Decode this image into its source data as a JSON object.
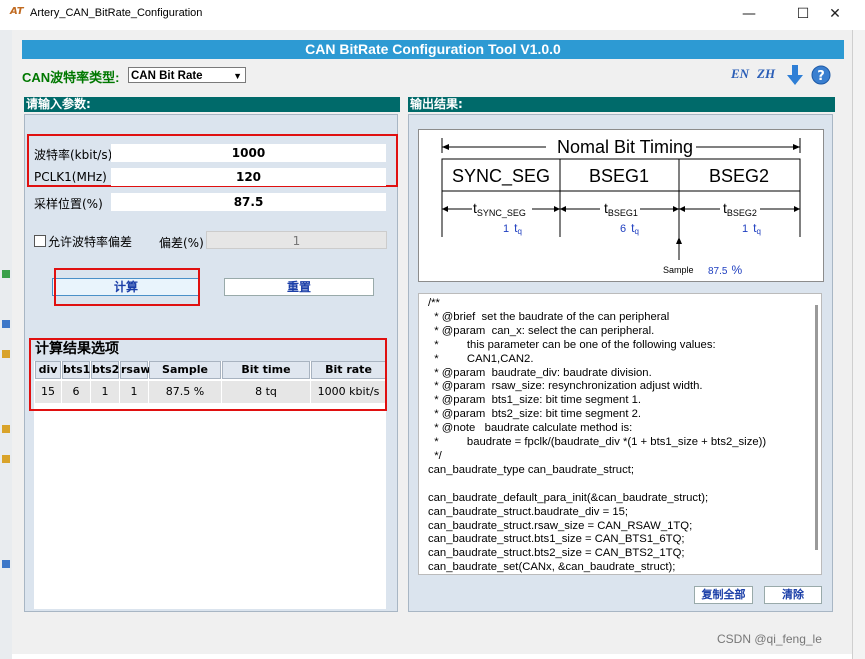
{
  "window": {
    "title": "Artery_CAN_BitRate_Configuration",
    "minimize": "—",
    "maximize": "☐",
    "close": "✕"
  },
  "header": {
    "title": "CAN BitRate Configuration Tool V1.0.0"
  },
  "type_selector": {
    "label": "CAN波特率类型:",
    "value": "CAN Bit Rate"
  },
  "lang": {
    "en": "EN",
    "zh": "ZH"
  },
  "input": {
    "section_title": "请输入参数:",
    "baud_label": "波特率(kbit/s)",
    "baud_value": "1000",
    "pclk_label": "PCLK1(MHz)",
    "pclk_value": "120",
    "sample_label": "采样位置(%)",
    "sample_value": "87.5",
    "allow_dev_label": "允许波特率偏差",
    "dev_label": "偏差(%)",
    "dev_value": "1",
    "calc_button": "计算",
    "reset_button": "重置"
  },
  "results": {
    "title": "计算结果选项",
    "columns": [
      "div",
      "bts1",
      "bts2",
      "rsaw",
      "Sample point",
      "Bit time length",
      "Bit rate"
    ],
    "rows": [
      [
        "15",
        "6",
        "1",
        "1",
        "87.5 %",
        "8 tq",
        "1000 kbit/s"
      ]
    ]
  },
  "output": {
    "section_title": "输出结果:",
    "diagram": {
      "title": "Nomal Bit Timing",
      "seg1": "SYNC_SEG",
      "seg2": "BSEG1",
      "seg3": "BSEG2",
      "t1_main": "t",
      "t1_sub": "SYNC_SEG",
      "t2_main": "t",
      "t2_sub": "BSEG1",
      "t3_main": "t",
      "t3_sub": "BSEG2",
      "v1": "1",
      "v2": "6",
      "v3": "1",
      "tq_main": "t",
      "tq_sub": "q",
      "sample_label": "Sample",
      "sample_value": "87.5",
      "sample_unit": "%"
    },
    "code": "/**\n  * @brief  set the baudrate of the can peripheral\n  * @param  can_x: select the can peripheral.\n  *         this parameter can be one of the following values:\n  *         CAN1,CAN2.\n  * @param  baudrate_div: baudrate division.\n  * @param  rsaw_size: resynchronization adjust width.\n  * @param  bts1_size: bit time segment 1.\n  * @param  bts2_size: bit time segment 2.\n  * @note   baudrate calculate method is:\n  *         baudrate = fpclk/(baudrate_div *(1 + bts1_size + bts2_size))\n  */\ncan_baudrate_type can_baudrate_struct;\n\ncan_baudrate_default_para_init(&can_baudrate_struct);\ncan_baudrate_struct.baudrate_div = 15;\ncan_baudrate_struct.rsaw_size = CAN_RSAW_1TQ;\ncan_baudrate_struct.bts1_size = CAN_BTS1_6TQ;\ncan_baudrate_struct.bts2_size = CAN_BTS2_1TQ;\ncan_baudrate_set(CANx, &can_baudrate_struct);",
    "copy_button": "复制全部",
    "clear_button": "清除"
  },
  "watermark": "CSDN @qi_feng_le",
  "colors": {
    "header_blue": "#2d9ad3",
    "section_teal": "#006a6a",
    "panel_bg": "#dbe4ee",
    "highlight_red": "#e01010",
    "label_green": "#007800",
    "link_blue": "#1b3fa8"
  }
}
